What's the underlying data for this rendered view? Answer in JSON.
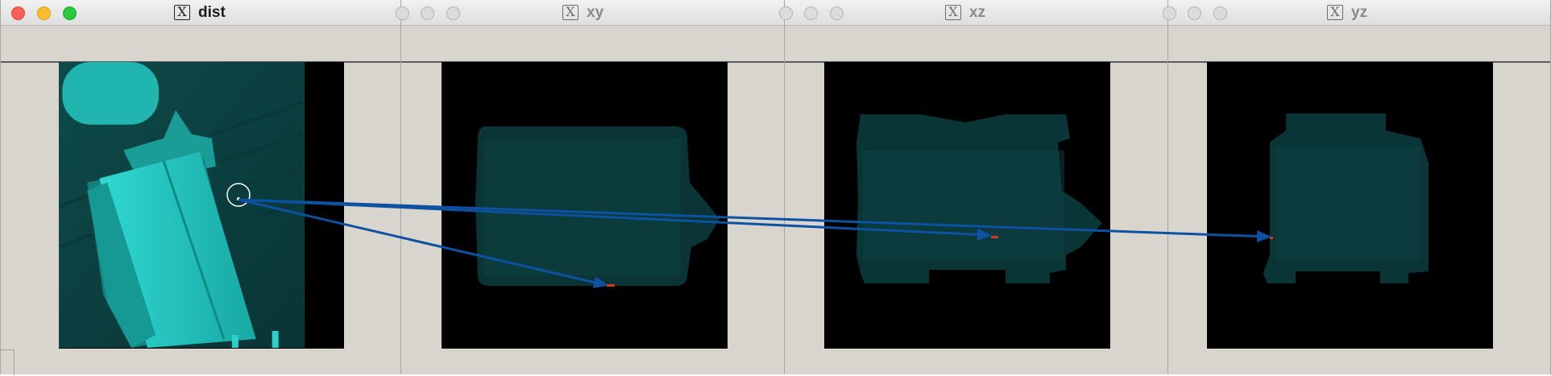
{
  "windows": [
    {
      "id": "dist",
      "title": "dist",
      "active": true
    },
    {
      "id": "xy",
      "title": "xy",
      "active": false
    },
    {
      "id": "xz",
      "title": "xz",
      "active": false
    },
    {
      "id": "yz",
      "title": "yz",
      "active": false
    }
  ],
  "title_icon": "x11-icon",
  "colors": {
    "window_bg": "#d8d5cf",
    "canvas_bg": "#000000",
    "object_cyan": "#1fc9c3",
    "point_cloud": "#0c3f40",
    "arrow": "#0d52a2",
    "marker_red": "#d23c1e",
    "close": "#fc5f57",
    "minimize": "#fdbc2e",
    "zoom": "#28c840"
  }
}
